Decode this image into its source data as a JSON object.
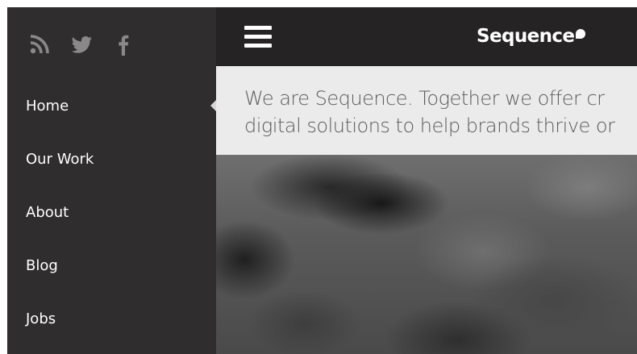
{
  "social": {
    "icons": [
      "rss-icon",
      "twitter-icon",
      "facebook-icon"
    ],
    "icon_color": "#8a8888"
  },
  "nav": {
    "items": [
      {
        "label": "Home",
        "active": true
      },
      {
        "label": "Our Work",
        "active": false
      },
      {
        "label": "About",
        "active": false
      },
      {
        "label": "Blog",
        "active": false
      },
      {
        "label": "Jobs",
        "active": false
      }
    ]
  },
  "header": {
    "logo_text": "Sequence",
    "menu_icon": "hamburger-icon"
  },
  "intro": {
    "text": "We are Sequence. Together we offer cr\ndigital solutions to help brands thrive or"
  },
  "colors": {
    "sidebar_bg": "#2f2d2d",
    "topbar_bg": "#252323",
    "intro_bg": "#ebebeb",
    "intro_text": "#5b5b5b"
  }
}
